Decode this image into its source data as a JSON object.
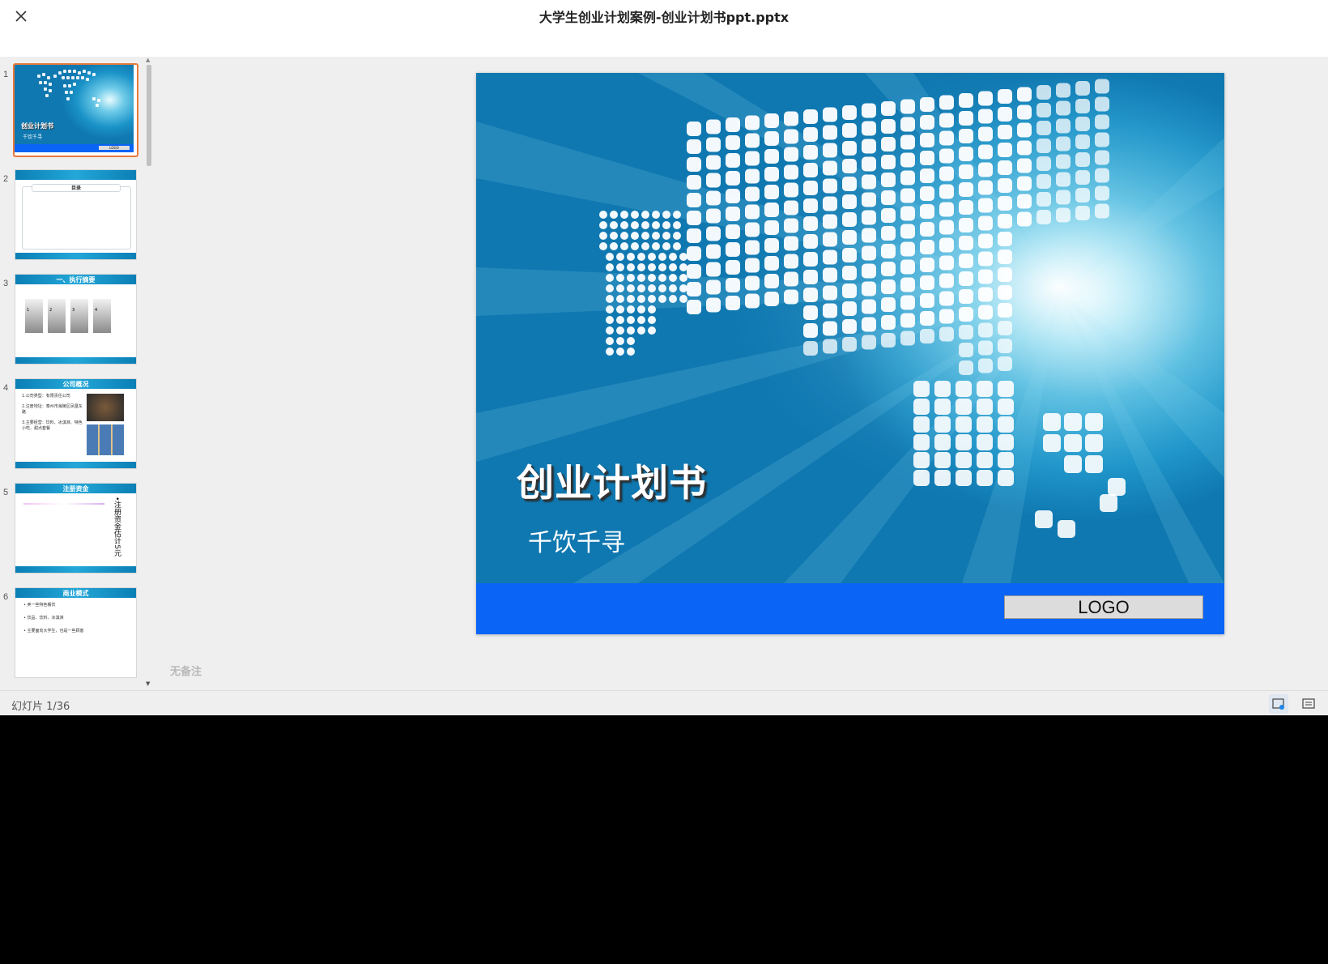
{
  "header": {
    "title": "大学生创业计划案例-创业计划书ppt.pptx"
  },
  "sidebar": {
    "thumbnails": [
      {
        "number": "1",
        "title": "创业计划书",
        "subtitle": "千饮千寻",
        "logo": "LOGO"
      },
      {
        "number": "2",
        "header": "目录"
      },
      {
        "number": "3",
        "header": "一、执行摘要",
        "items": [
          "1",
          "2",
          "3",
          "4"
        ]
      },
      {
        "number": "4",
        "header": "公司概况",
        "lines": [
          "1.公司类型：有限责任公司",
          "2.注册地址：泰州市海陵区凤凰东路",
          "3.主要经营：饮料、冰淇淋、特色小吃、甜点套餐"
        ]
      },
      {
        "number": "5",
        "header": "注册资金",
        "side_text": "•注册资金估计5元"
      },
      {
        "number": "6",
        "header": "商业模式",
        "lines": [
          "• 卖一些特色餐饮",
          "• 饮品、饮料、冰淇淋",
          "• 主要面向大学生，也是一些顾客"
        ]
      }
    ]
  },
  "slide": {
    "title": "创业计划书",
    "subtitle": "千饮千寻",
    "logo": "LOGO",
    "colors": {
      "bottom_bar": "#0a64f6",
      "background": "#1a93c8"
    }
  },
  "notes": "无备注",
  "status": {
    "counter": "幻灯片 1/36"
  }
}
